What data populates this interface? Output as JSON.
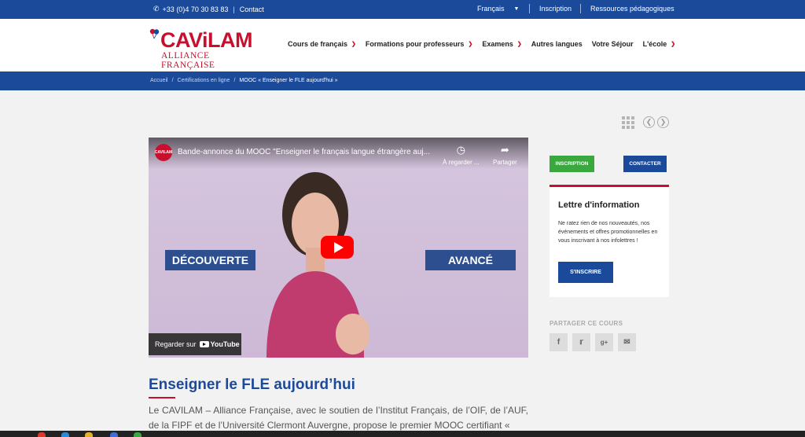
{
  "topbar": {
    "phone": "+33 (0)4 70 30 83 83",
    "separator": "|",
    "contact": "Contact",
    "language": "Français",
    "inscription": "Inscription",
    "resources": "Ressources pédagogiques"
  },
  "header": {
    "logo_name": "CAViLAM",
    "logo_sub": "ALLIANCE FRANÇAISE",
    "nav": [
      {
        "label": "Cours de français",
        "has_dropdown": true
      },
      {
        "label": "Formations pour professeurs",
        "has_dropdown": true
      },
      {
        "label": "Examens",
        "has_dropdown": true
      },
      {
        "label": "Autres langues",
        "has_dropdown": false
      },
      {
        "label": "Votre Séjour",
        "has_dropdown": false
      },
      {
        "label": "L'école",
        "has_dropdown": true
      }
    ]
  },
  "breadcrumb": {
    "items": [
      "Accueil",
      "Certifications en ligne",
      "MOOC « Enseigner le FLE aujourd'hui »"
    ],
    "separator": "/"
  },
  "video": {
    "channel": "CAVILAM",
    "title": "Bande-annonce du MOOC \"Enseigner le français langue étrangère auj...",
    "watch_later": "À regarder ...",
    "share": "Partager",
    "left_label": "DÉCOUVERTE",
    "right_label": "AVANCÉ",
    "watch_on": "Regarder sur",
    "youtube": "YouTube"
  },
  "sidebar": {
    "inscription_btn": "INSCRIPTION",
    "contact_btn": "CONTACTER",
    "newsletter": {
      "title": "Lettre d'information",
      "text": "Ne ratez rien de nos nouveautés, nos événements et offres promotionnelles en vous inscrivant à nos infolettres !",
      "button": "S'INSCRIRE"
    },
    "share_title": "PARTAGER CE COURS",
    "share_icons": [
      "facebook-icon",
      "twitter-icon",
      "google-plus-icon",
      "email-icon"
    ]
  },
  "article": {
    "title": "Enseigner le FLE aujourd’hui",
    "body": "Le CAVILAM – Alliance Française, avec le soutien de l’Institut Français, de l’OIF, de l’AUF, de la FIPF et de l’Université Clermont Auvergne, propose le premier MOOC certifiant «"
  },
  "colors": {
    "brand_blue": "#1c4a9b",
    "brand_red": "#c8102e",
    "green": "#3aa83f"
  }
}
